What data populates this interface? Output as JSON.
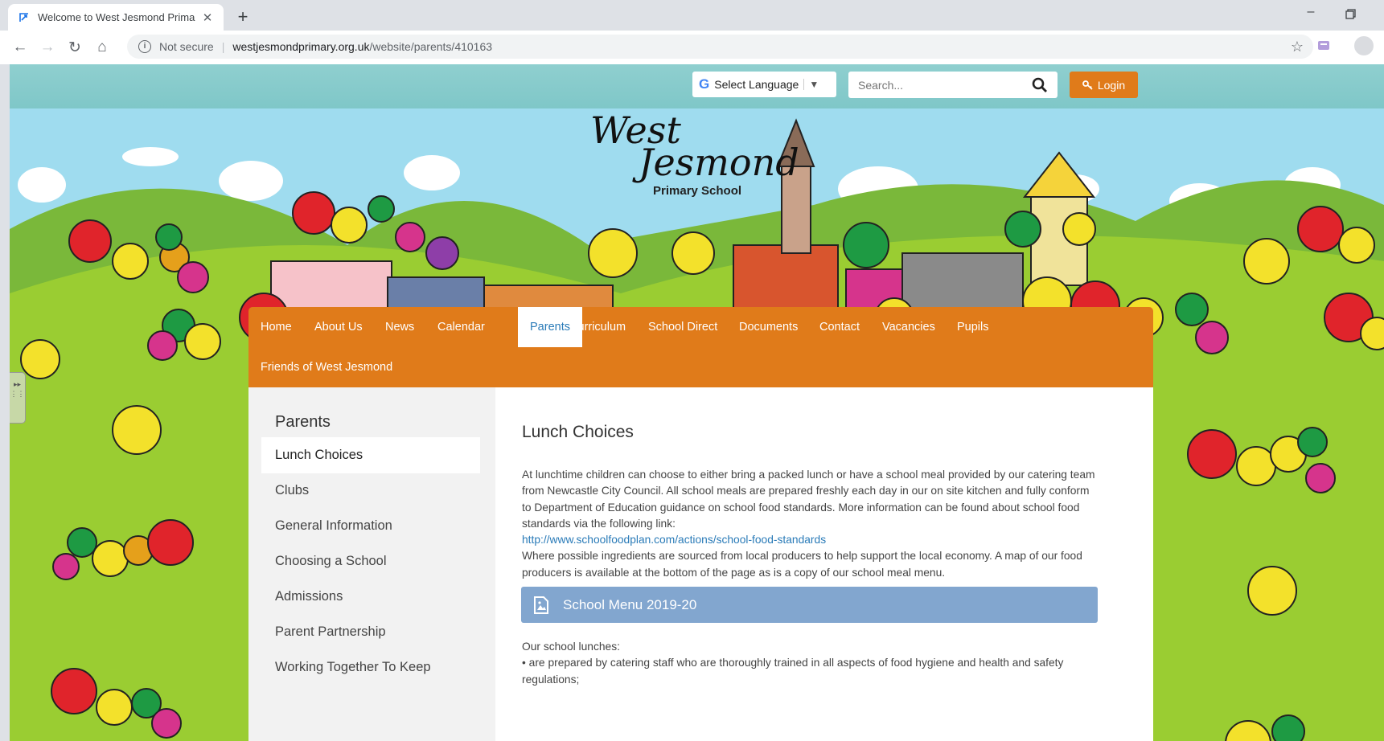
{
  "browser": {
    "tab_title": "Welcome to West Jesmond Prima",
    "tab_close": "✕",
    "new_tab": "+",
    "minimize": "–",
    "security_label": "Not secure",
    "url_domain": "westjesmondprimary.org.uk",
    "url_path": "/website/parents/410163"
  },
  "header": {
    "select_language": "Select Language",
    "search_placeholder": "Search...",
    "login_label": "Login"
  },
  "logo": {
    "line1": "West",
    "line2": "Jesmond",
    "line3": "Primary School"
  },
  "nav": {
    "items": [
      {
        "label": "Home"
      },
      {
        "label": "About Us"
      },
      {
        "label": "News"
      },
      {
        "label": "Calendar"
      },
      {
        "label": "Parents"
      },
      {
        "label": "Curriculum"
      },
      {
        "label": "School Direct"
      },
      {
        "label": "Documents"
      },
      {
        "label": "Contact"
      },
      {
        "label": "Vacancies"
      },
      {
        "label": "Pupils"
      },
      {
        "label": "Friends of West Jesmond"
      }
    ],
    "active": "Parents"
  },
  "sidebar": {
    "heading": "Parents",
    "items": [
      {
        "label": "Lunch Choices"
      },
      {
        "label": "Clubs"
      },
      {
        "label": "General Information"
      },
      {
        "label": "Choosing a School"
      },
      {
        "label": "Admissions"
      },
      {
        "label": "Parent Partnership"
      },
      {
        "label": "Working Together To Keep"
      }
    ]
  },
  "main": {
    "title": "Lunch Choices",
    "intro": "At lunchtime children can choose to either bring a packed lunch or have a school meal provided by our catering team from Newcastle City Council. All school meals are prepared freshly each day in our on site kitchen and fully conform to Department of Education guidance on school food standards. More information can be found about school food standards via the following link:",
    "link": "http://www.schoolfoodplan.com/actions/school-food-standards",
    "producers": "Where possible ingredients are sourced from local producers to help support the local economy. A map of our food producers is available at the bottom of the page as is a copy of our school meal menu.",
    "menu_file": "School Menu 2019-20",
    "lunches_heading": "Our school lunches:",
    "lunches_bullet": "• are prepared by catering staff who are thoroughly trained in all aspects of food hygiene and health and safety regulations;"
  },
  "colors": {
    "accent_orange": "#e07b1a",
    "link_blue": "#2a7bb8",
    "menu_bar": "#82a6cf",
    "grass": "#9acd32",
    "sky": "#9fdcef"
  }
}
